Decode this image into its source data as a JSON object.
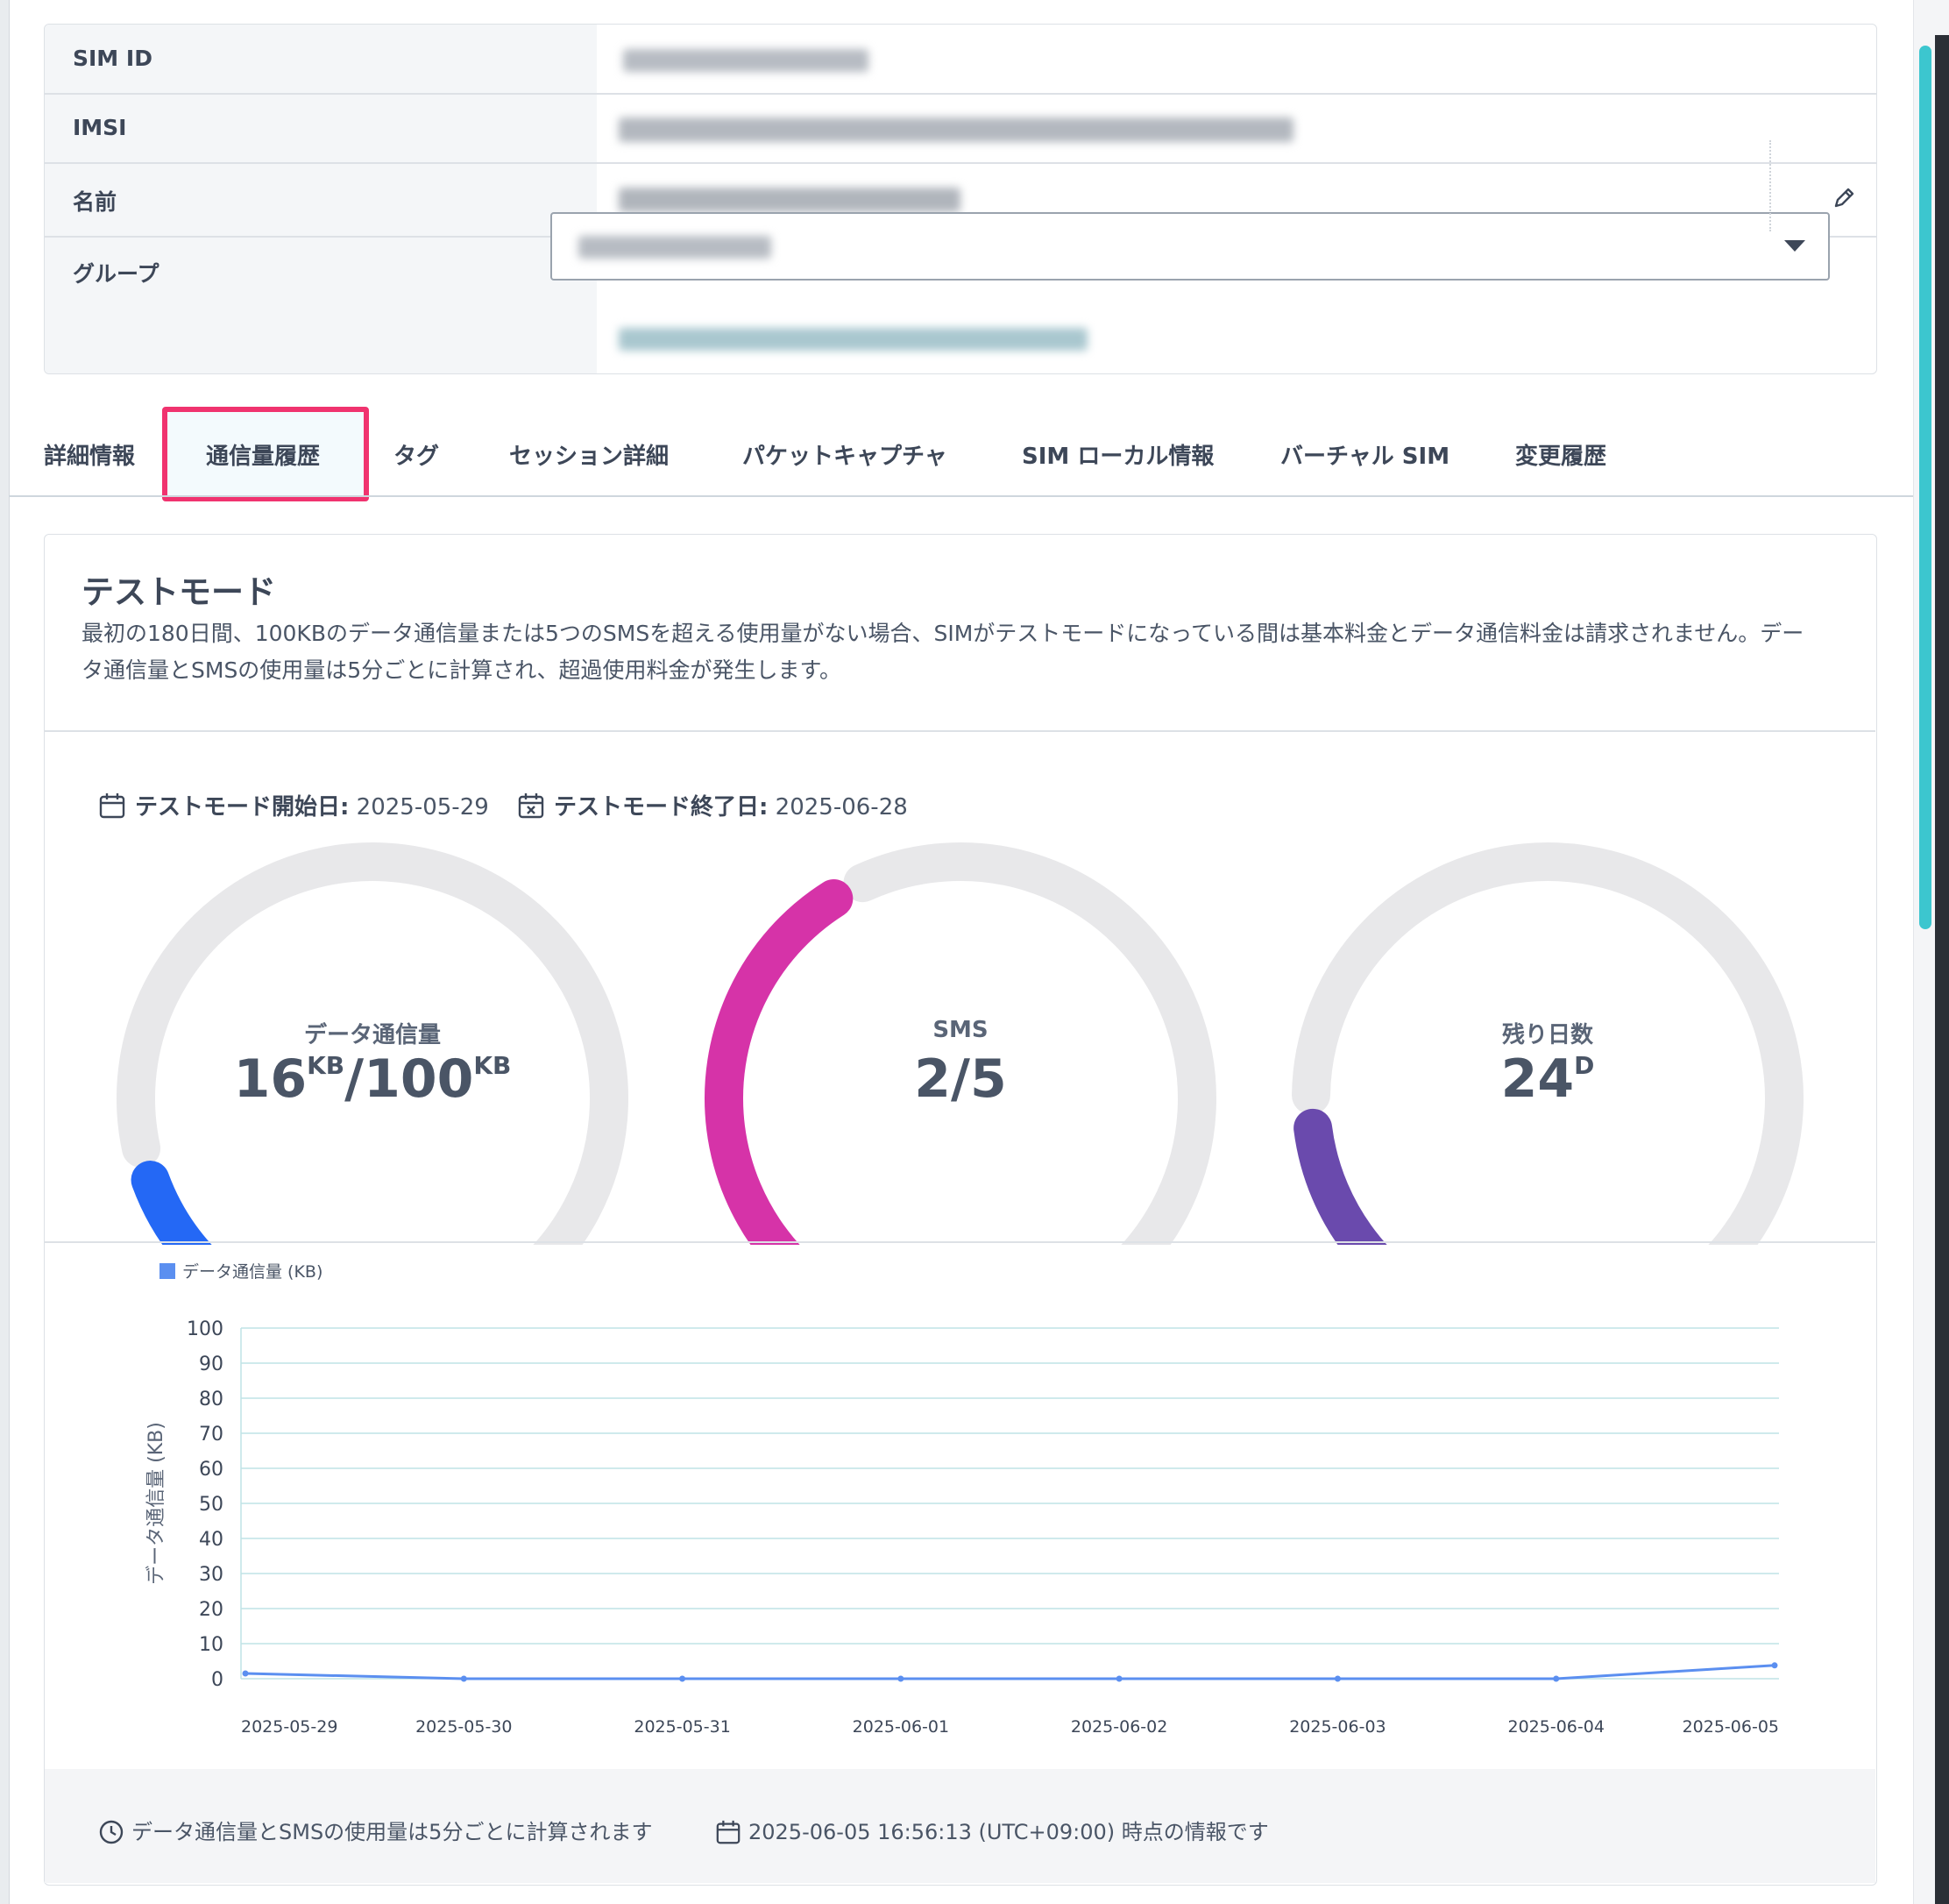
{
  "info": {
    "rows": [
      {
        "label": "SIM ID"
      },
      {
        "label": "IMSI"
      },
      {
        "label": "名前"
      },
      {
        "label": "グループ"
      }
    ]
  },
  "tabs": [
    {
      "label": "詳細情報",
      "active": false
    },
    {
      "label": "通信量履歴",
      "active": true
    },
    {
      "label": "タグ",
      "active": false
    },
    {
      "label": "セッション詳細",
      "active": false
    },
    {
      "label": "パケットキャプチャ",
      "active": false
    },
    {
      "label": "SIM ローカル情報",
      "active": false
    },
    {
      "label": "バーチャル SIM",
      "active": false
    },
    {
      "label": "変更履歴",
      "active": false
    }
  ],
  "test_mode": {
    "title": "テストモード",
    "description": "最初の180日間、100KBのデータ通信量または5つのSMSを超える使用量がない場合、SIMがテストモードになっている間は基本料金とデータ通信料金は請求されません。データ通信量とSMSの使用量は5分ごとに計算され、超過使用料金が発生します。",
    "start_label": "テストモード開始日:",
    "start_date": "2025-05-29",
    "end_label": "テストモード終了日:",
    "end_date": "2025-06-28"
  },
  "gauges": [
    {
      "label": "データ通信量",
      "value": "16",
      "value_unit": "KB",
      "sep": "/",
      "max": "100",
      "max_unit": "KB",
      "fraction": 0.16,
      "color": "#2468f5"
    },
    {
      "label": "SMS",
      "value": "2",
      "value_unit": "",
      "sep": "/",
      "max": "5",
      "max_unit": "",
      "fraction": 0.4,
      "color": "#d633a8"
    },
    {
      "label": "残り日数",
      "value": "24",
      "value_unit": "D",
      "sep": "",
      "max": "",
      "max_unit": "",
      "fraction": 0.2,
      "color": "#6a4aad"
    }
  ],
  "gauge_track_color": "#e8e8ea",
  "chart_data": {
    "type": "line",
    "legend": "データ通信量 (KB)",
    "ylabel": "データ通信量 (KB)",
    "xlabel": "",
    "ylim": [
      0,
      100
    ],
    "yticks": [
      0,
      10,
      20,
      30,
      40,
      50,
      60,
      70,
      80,
      90,
      100
    ],
    "categories": [
      "2025-05-29",
      "2025-05-30",
      "2025-05-31",
      "2025-06-01",
      "2025-06-02",
      "2025-06-03",
      "2025-06-04",
      "2025-06-05"
    ],
    "series": [
      {
        "name": "データ通信量 (KB)",
        "color": "#5b8ff0",
        "values": [
          1.5,
          0,
          0,
          0,
          0,
          0,
          0,
          3.8
        ]
      }
    ],
    "grid": true,
    "legend_position": "top-left"
  },
  "footer": {
    "note": "データ通信量とSMSの使用量は5分ごとに計算されます",
    "timestamp": "2025-06-05 16:56:13 (UTC+09:00) 時点の情報です"
  }
}
